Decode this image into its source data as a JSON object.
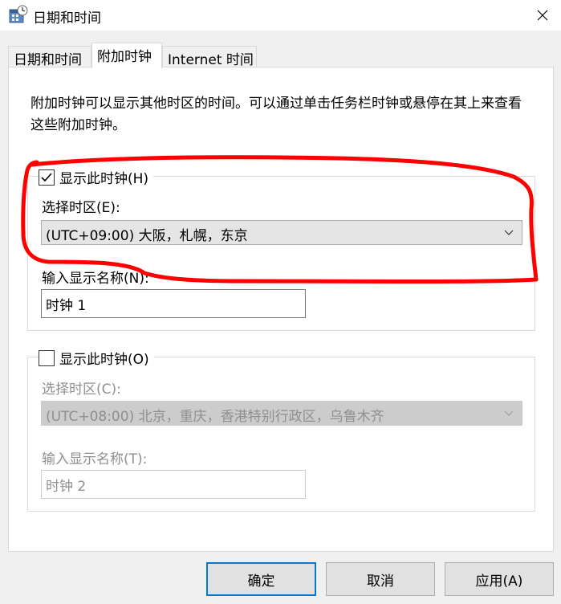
{
  "window": {
    "title": "日期和时间",
    "close_icon": "close-icon"
  },
  "tabs": [
    {
      "label": "日期和时间",
      "active": false
    },
    {
      "label": "附加时钟",
      "active": true
    },
    {
      "label": "Internet 时间",
      "active": false
    }
  ],
  "description": "附加时钟可以显示其他时区的时间。可以通过单击任务栏时钟或悬停在其上来查看这些附加时钟。",
  "clock1": {
    "show_label": "显示此时钟(H)",
    "checked": true,
    "timezone_label": "选择时区(E):",
    "timezone_value": "(UTC+09:00) 大阪，札幌，东京",
    "name_label": "输入显示名称(N):",
    "name_value": "时钟 1"
  },
  "clock2": {
    "show_label": "显示此时钟(O)",
    "checked": false,
    "timezone_label": "选择时区(C):",
    "timezone_value": "(UTC+08:00) 北京，重庆，香港特别行政区，乌鲁木齐",
    "name_label": "输入显示名称(T):",
    "name_value": "时钟 2"
  },
  "buttons": {
    "ok": "确定",
    "cancel": "取消",
    "apply": "应用(A)"
  },
  "annotation_color": "#ff0000"
}
